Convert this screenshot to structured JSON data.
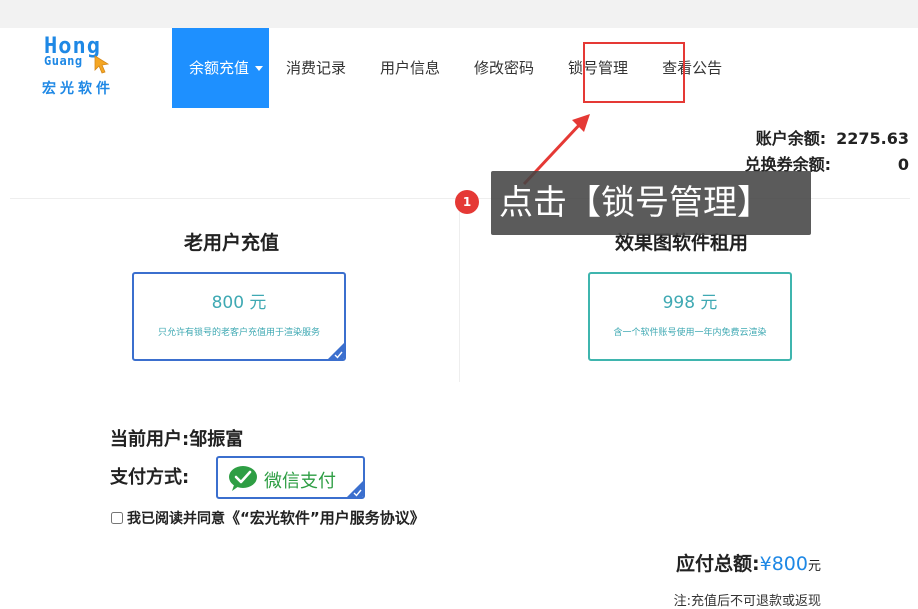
{
  "logo": {
    "line1": "Hong",
    "line2": "Guang",
    "brand_cn": "宏光软件"
  },
  "nav": {
    "items": [
      {
        "label": "余额充值",
        "active": true
      },
      {
        "label": "消费记录"
      },
      {
        "label": "用户信息"
      },
      {
        "label": "修改密码"
      },
      {
        "label": "锁号管理",
        "highlighted": true
      },
      {
        "label": "查看公告"
      }
    ]
  },
  "balance": {
    "account_label": "账户余额:",
    "account_value": "2275.63",
    "voucher_label": "兑换券余额:",
    "voucher_value": "0"
  },
  "annotation": {
    "step": "1",
    "text": "点击【锁号管理】"
  },
  "plans": [
    {
      "title": "老用户充值",
      "price": "800 元",
      "desc": "只允许有锁号的老客户充值用于渲染服务",
      "selected": true
    },
    {
      "title": "效果图软件租用",
      "price": "998 元",
      "desc": "含一个软件账号使用一年内免费云渲染",
      "selected": false
    }
  ],
  "user": {
    "label": "当前用户:",
    "name": "邹振富"
  },
  "payment": {
    "label": "支付方式:",
    "method": "微信支付"
  },
  "agreement": {
    "prefix": "我已阅读并同意",
    "link": "《“宏光软件”用户服务协议》"
  },
  "total": {
    "label": "应付总额:",
    "amount": "¥800",
    "unit": "元"
  },
  "note": "注:充值后不可退款或返现",
  "colors": {
    "accent": "#1e90ff",
    "highlight": "#e53935",
    "wechat": "#2e9e44"
  }
}
